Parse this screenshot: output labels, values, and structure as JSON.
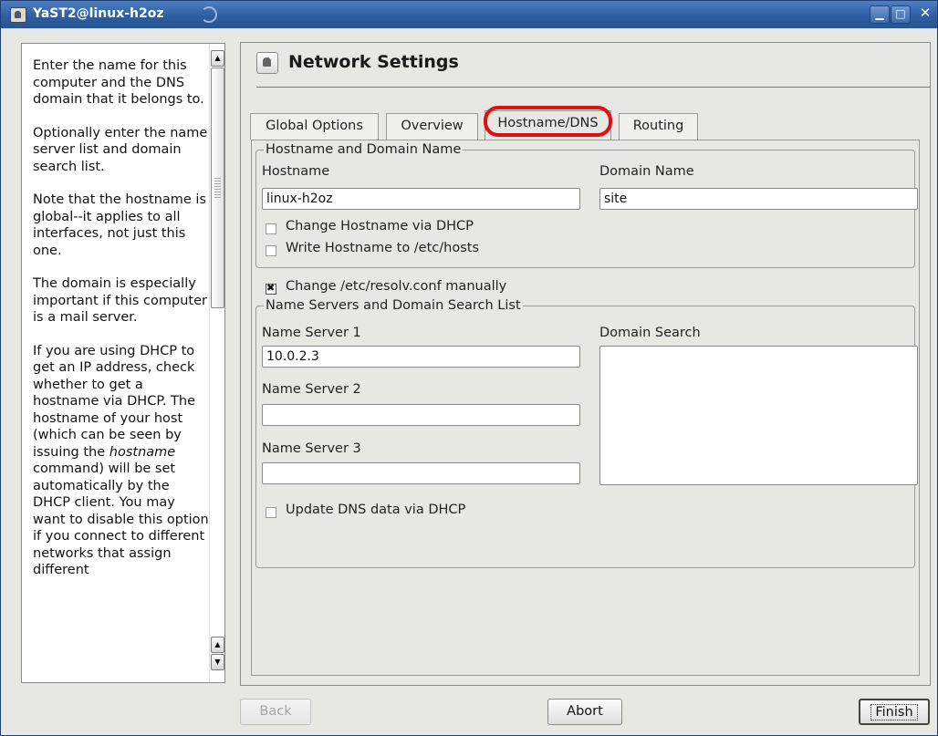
{
  "window": {
    "title": "YaST2@linux-h2oz",
    "minimize_glyph": "▁",
    "maximize_glyph": "□",
    "close_glyph": "✕"
  },
  "help": {
    "paragraphs": [
      "Enter the name for this computer and the DNS domain that it belongs to.",
      "Optionally enter the name server list and domain search list.",
      "Note that the hostname is global--it applies to all interfaces, not just this one.",
      "The domain is especially important if this computer is a mail server."
    ],
    "last_paragraph": {
      "before": "If you are using DHCP to get an IP address, check whether to get a hostname via DHCP. The hostname of your host (which can be seen by issuing the ",
      "italic": "hostname",
      "after": " command) will be set automatically by the DHCP client. You may want to disable this option if you connect to different networks that assign different"
    }
  },
  "main": {
    "heading": "Network Settings",
    "tabs": [
      "Global Options",
      "Overview",
      "Hostname/DNS",
      "Routing"
    ],
    "active_tab": "Hostname/DNS",
    "highlight_color": "#e01010",
    "hostname_group": {
      "legend": "Hostname and Domain Name",
      "hostname_label": "Hostname",
      "hostname_value": "linux-h2oz",
      "domain_label": "Domain Name",
      "domain_value": "site",
      "change_hostname_dhcp": "Change Hostname via DHCP",
      "change_hostname_dhcp_checked": false,
      "write_hostname_hosts": "Write Hostname to /etc/hosts",
      "write_hostname_hosts_checked": false
    },
    "resolv_manual": "Change /etc/resolv.conf manually",
    "resolv_manual_checked": true,
    "nameserver_group": {
      "legend": "Name Servers and Domain Search List",
      "ns1_label": "Name Server 1",
      "ns1_value": "10.0.2.3",
      "ns2_label": "Name Server 2",
      "ns2_value": "",
      "ns3_label": "Name Server 3",
      "ns3_value": "",
      "domain_search_label": "Domain Search",
      "update_dns_dhcp": "Update DNS data via DHCP",
      "update_dns_dhcp_checked": false
    }
  },
  "buttons": {
    "back": "Back",
    "abort": "Abort",
    "finish": "Finish"
  }
}
